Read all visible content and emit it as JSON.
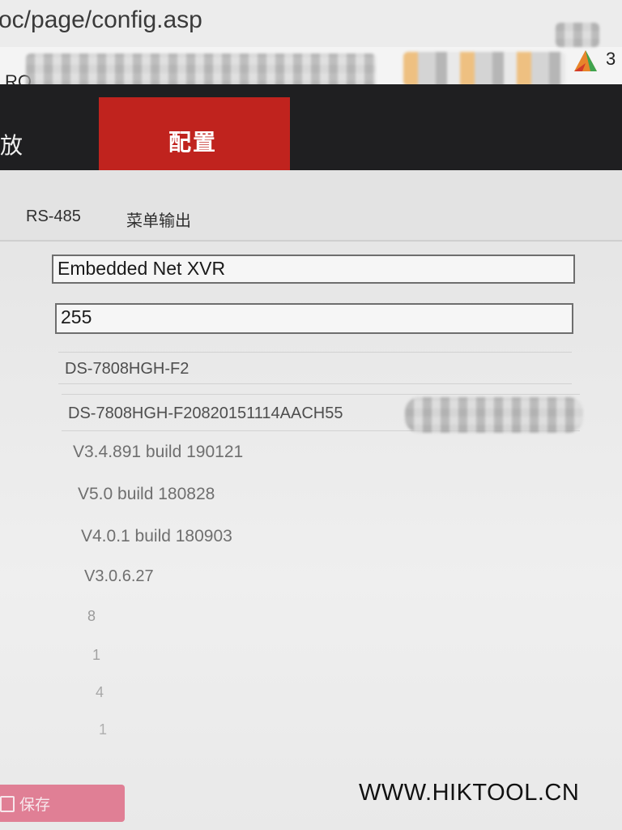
{
  "browser": {
    "address": "oc/page/config.asp",
    "bookmark_label": "RO",
    "bookmark_count": "3"
  },
  "nav": {
    "playback_label": "放",
    "config_label": "配置",
    "active_color": "#c0231e"
  },
  "sub_tabs": [
    "RS-485",
    "菜单输出"
  ],
  "device_info": {
    "device_name": "Embedded Net XVR",
    "device_number": "255",
    "model": "DS-7808HGH-F2",
    "serial_number": "DS-7808HGH-F20820151114AACH55",
    "firmware_version": "V3.4.891 build 190121",
    "encoding_version": "V5.0 build 180828",
    "web_version": "V4.0.1 build 180903",
    "plugin_version": "V3.0.6.27",
    "channels": "8",
    "hdds": "1",
    "alarm_inputs": "4",
    "alarm_outputs": "1"
  },
  "footer": {
    "save_label": "保存",
    "save_color": "#e07f95"
  },
  "watermark": "WWW.HIKTOOL.CN"
}
